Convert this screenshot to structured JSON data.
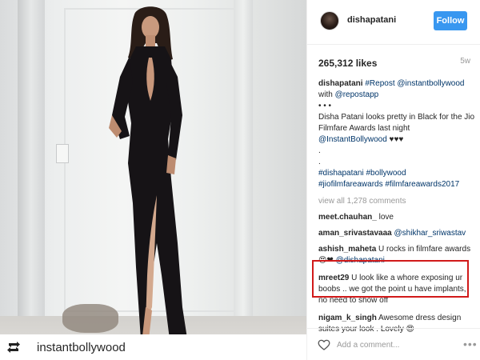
{
  "photo": {
    "repost_handle": "instantbollywood",
    "repost_icon": "retweet-icon"
  },
  "header": {
    "username": "dishapatani",
    "follow_label": "Follow"
  },
  "post": {
    "likes": "265,312 likes",
    "age": "5w"
  },
  "caption": {
    "user": "dishapatani",
    "repost_tag": "#Repost",
    "mention": "@instantbollywood",
    "with_text": "with",
    "repostapp": "@repostapp",
    "dots": "• • •",
    "body": "Disha Patani looks pretty in Black for the Jio Filmfare Awards last night",
    "instant": "@InstantBollywood",
    "hearts": "♥♥♥",
    "period": ".",
    "hashtags_line1": "#dishapatani #bollywood",
    "hashtags_line2": "#jiofilmfareawards #filmfareawards2017"
  },
  "view_all": "view all 1,278 comments",
  "comments": [
    {
      "user": "meet.chauhan_",
      "text": "love"
    },
    {
      "user": "aman_srivastavaaa",
      "text": "@shikhar_sriwastav"
    },
    {
      "user": "ashish_maheta",
      "text": "U rocks in filmfare awards",
      "text2_emoji": "😍❤",
      "text2_mention": "@dishapatani"
    },
    {
      "user": "mreet29",
      "text": "U look like a whore exposing ur boobs .. we got the point u have implants, no need to show off"
    },
    {
      "user": "nigam_k_singh",
      "text": "Awesome dress design suites your look . Lovely 😍"
    }
  ],
  "add_comment": {
    "placeholder": "Add a comment...",
    "more": "•••"
  },
  "colors": {
    "follow": "#3897f0",
    "highlight": "#d11a1a",
    "hashtag": "#003569"
  }
}
